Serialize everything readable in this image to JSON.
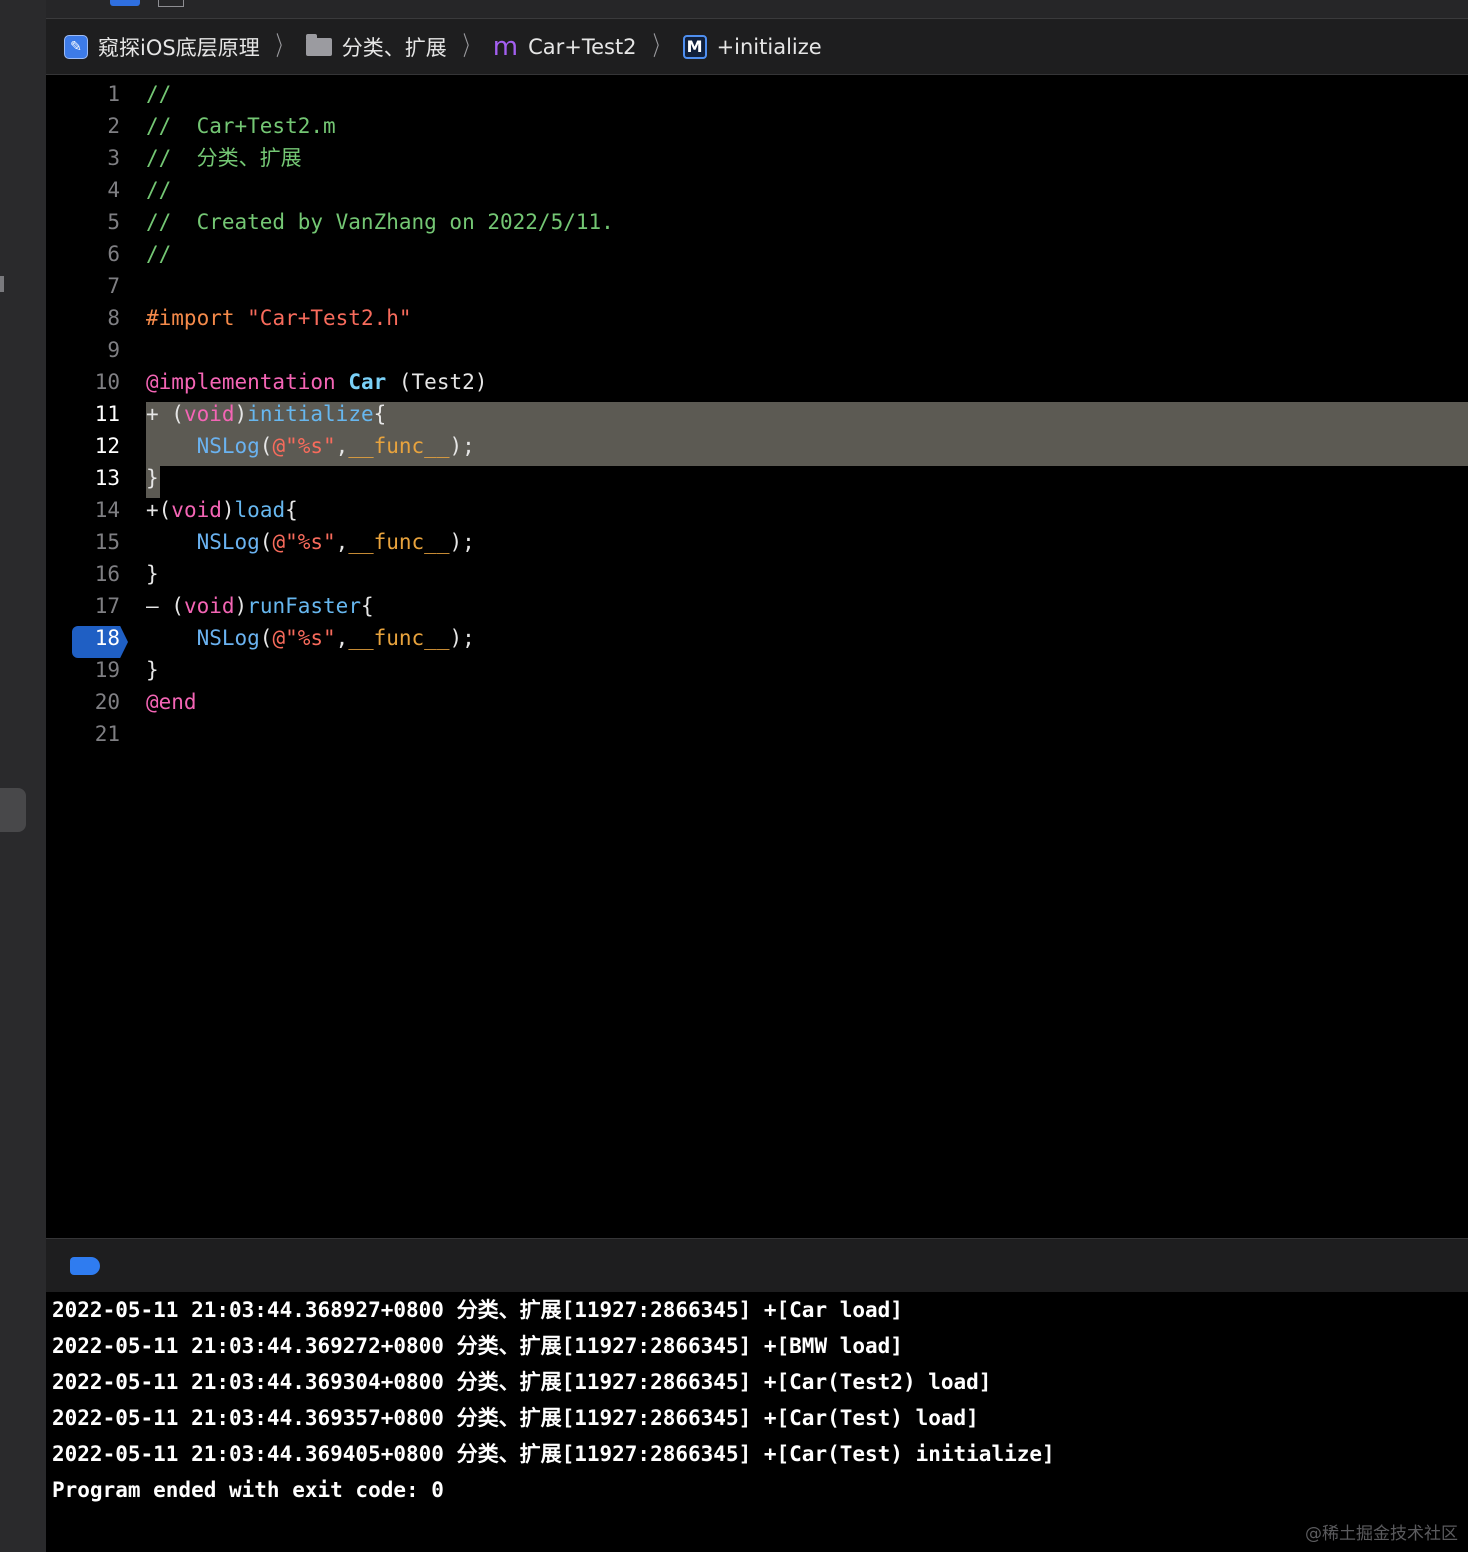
{
  "breadcrumb": {
    "project": "窥探iOS底层原理",
    "group": "分类、扩展",
    "file": "Car+Test2",
    "method": "+initialize"
  },
  "icons": {
    "project": "app-project-icon",
    "group": "folder-icon",
    "file": "objc-m-file-icon",
    "method": "method-M-icon"
  },
  "editor": {
    "current_line": 18,
    "highlight_lines": [
      11,
      12,
      13
    ],
    "lines": [
      {
        "n": "1",
        "tokens": [
          {
            "t": "//",
            "c": "c-com"
          }
        ]
      },
      {
        "n": "2",
        "tokens": [
          {
            "t": "//  Car+Test2.m",
            "c": "c-com"
          }
        ]
      },
      {
        "n": "3",
        "tokens": [
          {
            "t": "//  分类、扩展",
            "c": "c-com"
          }
        ]
      },
      {
        "n": "4",
        "tokens": [
          {
            "t": "//",
            "c": "c-com"
          }
        ]
      },
      {
        "n": "5",
        "tokens": [
          {
            "t": "//  Created by VanZhang on 2022/5/11.",
            "c": "c-com"
          }
        ]
      },
      {
        "n": "6",
        "tokens": [
          {
            "t": "//",
            "c": "c-com"
          }
        ]
      },
      {
        "n": "7",
        "tokens": []
      },
      {
        "n": "8",
        "tokens": [
          {
            "t": "#import ",
            "c": "c-pre"
          },
          {
            "t": "\"Car+Test2.h\"",
            "c": "c-str"
          }
        ]
      },
      {
        "n": "9",
        "tokens": []
      },
      {
        "n": "10",
        "tokens": [
          {
            "t": "@implementation",
            "c": "c-kw"
          },
          {
            "t": " ",
            "c": ""
          },
          {
            "t": "Car",
            "c": "c-cls"
          },
          {
            "t": " (Test2)",
            "c": ""
          }
        ]
      },
      {
        "n": "11",
        "tokens": [
          {
            "t": "+ (",
            "c": ""
          },
          {
            "t": "void",
            "c": "c-kw"
          },
          {
            "t": ")",
            "c": ""
          },
          {
            "t": "initialize",
            "c": "c-meth"
          },
          {
            "t": "{",
            "c": ""
          }
        ]
      },
      {
        "n": "12",
        "tokens": [
          {
            "t": "    ",
            "c": ""
          },
          {
            "t": "NSLog",
            "c": "c-fn"
          },
          {
            "t": "(",
            "c": ""
          },
          {
            "t": "@\"%s\"",
            "c": "c-str"
          },
          {
            "t": ",",
            "c": ""
          },
          {
            "t": "__func__",
            "c": "c-mac"
          },
          {
            "t": ");",
            "c": ""
          }
        ]
      },
      {
        "n": "13",
        "tokens": [
          {
            "t": "}",
            "c": ""
          }
        ]
      },
      {
        "n": "14",
        "tokens": [
          {
            "t": "+(",
            "c": ""
          },
          {
            "t": "void",
            "c": "c-kw"
          },
          {
            "t": ")",
            "c": ""
          },
          {
            "t": "load",
            "c": "c-meth"
          },
          {
            "t": "{",
            "c": ""
          }
        ]
      },
      {
        "n": "15",
        "tokens": [
          {
            "t": "    ",
            "c": ""
          },
          {
            "t": "NSLog",
            "c": "c-fn"
          },
          {
            "t": "(",
            "c": ""
          },
          {
            "t": "@\"%s\"",
            "c": "c-str"
          },
          {
            "t": ",",
            "c": ""
          },
          {
            "t": "__func__",
            "c": "c-mac"
          },
          {
            "t": ");",
            "c": ""
          }
        ]
      },
      {
        "n": "16",
        "tokens": [
          {
            "t": "}",
            "c": ""
          }
        ]
      },
      {
        "n": "17",
        "tokens": [
          {
            "t": "– (",
            "c": ""
          },
          {
            "t": "void",
            "c": "c-kw"
          },
          {
            "t": ")",
            "c": ""
          },
          {
            "t": "runFaster",
            "c": "c-meth"
          },
          {
            "t": "{",
            "c": ""
          }
        ]
      },
      {
        "n": "18",
        "tokens": [
          {
            "t": "    ",
            "c": ""
          },
          {
            "t": "NSLog",
            "c": "c-fn"
          },
          {
            "t": "(",
            "c": ""
          },
          {
            "t": "@\"%s\"",
            "c": "c-str"
          },
          {
            "t": ",",
            "c": ""
          },
          {
            "t": "__func__",
            "c": "c-mac"
          },
          {
            "t": ");",
            "c": ""
          }
        ]
      },
      {
        "n": "19",
        "tokens": [
          {
            "t": "}",
            "c": ""
          }
        ]
      },
      {
        "n": "20",
        "tokens": [
          {
            "t": "@end",
            "c": "c-kw"
          }
        ]
      },
      {
        "n": "21",
        "tokens": []
      }
    ]
  },
  "console": {
    "lines": [
      "2022-05-11 21:03:44.368927+0800 分类、扩展[11927:2866345] +[Car load]",
      "2022-05-11 21:03:44.369272+0800 分类、扩展[11927:2866345] +[BMW load]",
      "2022-05-11 21:03:44.369304+0800 分类、扩展[11927:2866345] +[Car(Test2) load]",
      "2022-05-11 21:03:44.369357+0800 分类、扩展[11927:2866345] +[Car(Test) load]",
      "2022-05-11 21:03:44.369405+0800 分类、扩展[11927:2866345] +[Car(Test) initialize]",
      "Program ended with exit code: 0"
    ]
  },
  "watermark": "@稀土掘金技术社区",
  "colors": {
    "background": "#000000",
    "highlight": "#5c5a53",
    "breakpoint": "#1f5fc4",
    "comment": "#74c774",
    "keyword": "#f465b5",
    "string": "#f86b5c"
  }
}
